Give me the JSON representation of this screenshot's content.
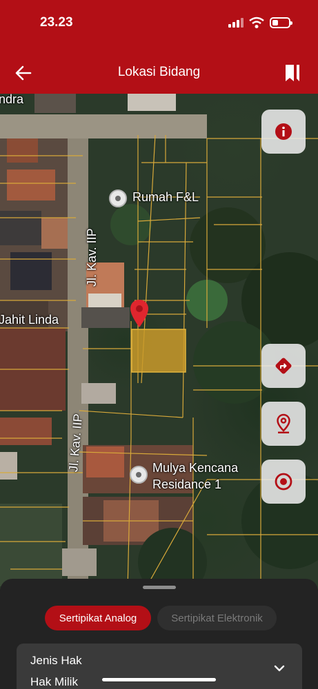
{
  "status_bar": {
    "time": "23.23"
  },
  "header": {
    "title": "Lokasi Bidang",
    "back_icon": "arrow-left-icon",
    "action_icon": "bookmark-icon"
  },
  "map": {
    "labels": {
      "top_left_partial": "ndra",
      "street_1": "Jl. Kav. IIP",
      "street_2": "Jl. Kav. IIP",
      "shop": "Jahit Linda",
      "poi_1": "Rumah F&L",
      "poi_2_line1": "Mulya Kencana",
      "poi_2_line2": "Residance 1"
    },
    "colors": {
      "parcel_fill": "#c99a2a",
      "parcel_lines": "#d8a93a",
      "pin": "#e0262e",
      "accent": "#b30f16"
    },
    "buttons": [
      "info-icon",
      "directions-icon",
      "location-pin-icon",
      "target-icon"
    ]
  },
  "sheet": {
    "tabs": [
      {
        "label": "Sertipikat Analog",
        "active": true
      },
      {
        "label": "Sertipikat Elektronik",
        "active": false
      }
    ],
    "card": {
      "label": "Jenis Hak",
      "value": "Hak Milik"
    }
  }
}
